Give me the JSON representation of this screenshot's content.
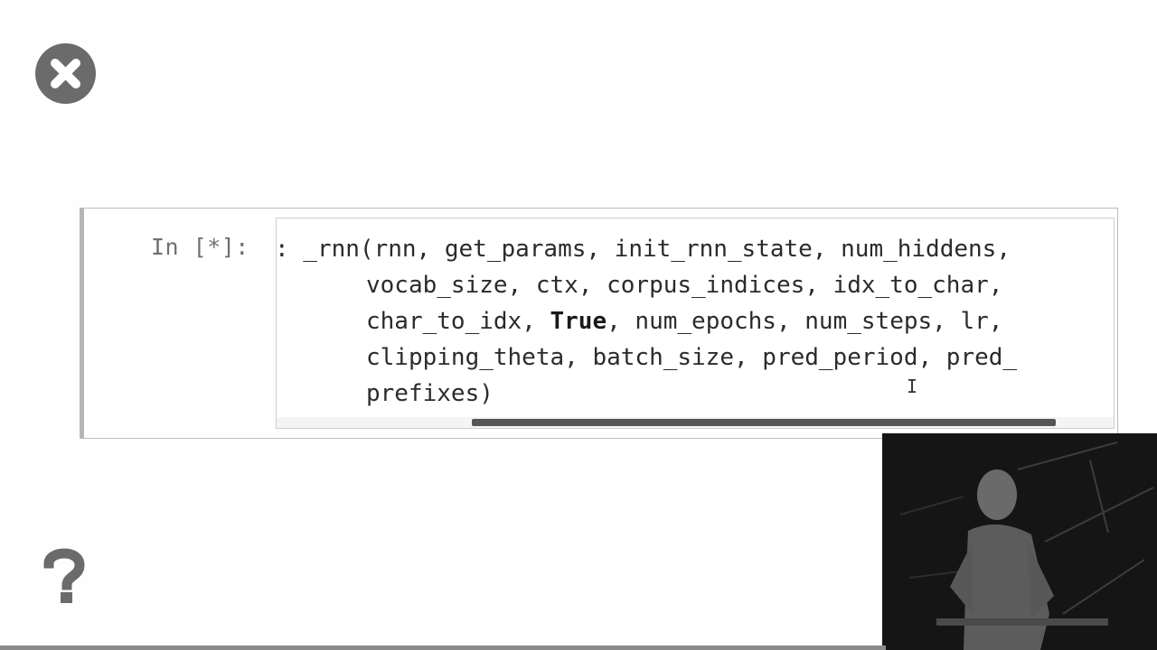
{
  "close_button": {
    "icon": "close-icon",
    "color": "#6b6b6b"
  },
  "help_button": {
    "icon": "question-icon",
    "color": "#6b6b6b"
  },
  "cell": {
    "prompt": "In [*]:",
    "lines": [
      {
        "segments": [
          ": _rnn(rnn, get_params, init_rnn_state, num_hiddens,"
        ]
      },
      {
        "segments": [
          "vocab_size, ctx, corpus_indices, idx_to_char,"
        ]
      },
      {
        "segments": [
          "char_to_idx, ",
          "True",
          ", num_epochs, num_steps, lr,"
        ]
      },
      {
        "segments": [
          "clipping_theta, batch_size, pred_period, pred_"
        ]
      },
      {
        "segments": [
          "prefixes)"
        ]
      }
    ]
  },
  "video_overlay": {
    "description_icon": "presenter-video"
  }
}
